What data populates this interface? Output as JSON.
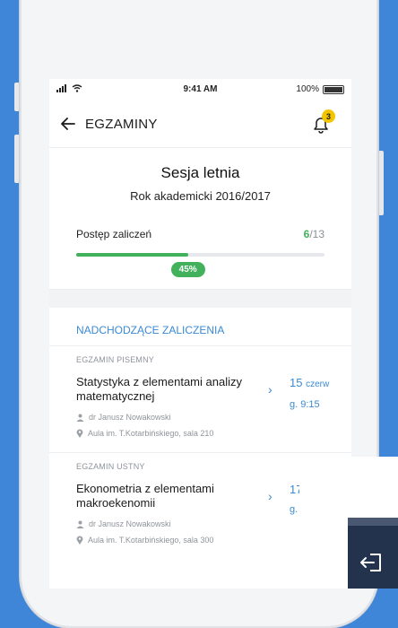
{
  "status": {
    "time": "9:41 AM",
    "battery": "100%"
  },
  "header": {
    "title": "EGZAMINY",
    "notifications": "3"
  },
  "session": {
    "title": "Sesja letnia",
    "year": "Rok akademicki 2016/2017"
  },
  "progress": {
    "label": "Postęp zaliczeń",
    "done": "6",
    "total": "/13",
    "percent_text": "45%",
    "fraction": 0.45
  },
  "upcoming": {
    "heading": "NADCHODZĄCE ZALICZENIA",
    "exams": [
      {
        "type": "EGZAMIN PISEMNY",
        "name": "Statystyka z elementami analizy matematycznej",
        "lecturer": "dr Janusz Nowakowski",
        "room": "Aula im. T.Kotarbińskiego, sala 210",
        "day": "15",
        "month": "czerw",
        "time": "g. 9:15"
      },
      {
        "type": "EGZAMIN USTNY",
        "name": "Ekonometria z elementami makroekenomii",
        "lecturer": "dr Janusz Nowakowski",
        "room": "Aula im. T.Kotarbińskiego, sala 300",
        "day": "17",
        "time": "g."
      }
    ]
  },
  "colors": {
    "accent": "#3b8ad3",
    "success": "#41b15b",
    "badge": "#f3c500",
    "background": "#3f86d8"
  }
}
